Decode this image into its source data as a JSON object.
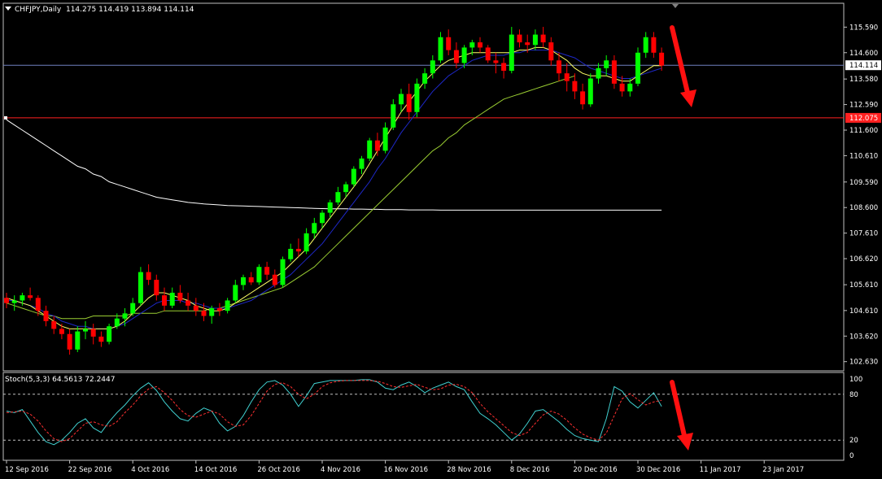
{
  "header": {
    "symbol_label": "CHFJPY,Daily",
    "ohlc_label": "114.275 114.419 113.894 114.114"
  },
  "stoch_header": {
    "label": "Stoch(5,3,3) 64.5613 72.2447"
  },
  "colors": {
    "background": "#000000",
    "bull_candle": "#00ff00",
    "bear_candle": "#ff0000",
    "ma_fast": "#ffff66",
    "ma_mid": "#1e28c8",
    "ma_slow": "#9acd32",
    "ma_long": "#ffffff",
    "stoch_main": "#40d0d0",
    "stoch_signal": "#ff3030",
    "support_line": "#ff2020",
    "current_line": "#7080c0",
    "arrow": "#ff1010"
  },
  "chart_data": [
    {
      "type": "candlestick",
      "symbol": "CHFJPY",
      "timeframe": "Daily",
      "ylim": [
        102.4,
        116.2
      ],
      "y_ticks": [
        "115.590",
        "114.600",
        "113.580",
        "112.590",
        "111.600",
        "110.610",
        "109.590",
        "108.600",
        "107.610",
        "106.620",
        "105.610",
        "104.610",
        "103.620",
        "102.630"
      ],
      "x_tick_labels": [
        "12 Sep 2016",
        "22 Sep 2016",
        "4 Oct 2016",
        "14 Oct 2016",
        "26 Oct 2016",
        "4 Nov 2016",
        "16 Nov 2016",
        "28 Nov 2016",
        "8 Dec 2016",
        "20 Dec 2016",
        "30 Dec 2016",
        "11 Jan 2017",
        "23 Jan 2017"
      ],
      "x_tick_index": [
        0,
        8,
        16,
        24,
        32,
        40,
        48,
        56,
        64,
        72,
        80,
        88,
        96
      ],
      "current_price": "114.114",
      "support_level": "112.075",
      "candles": [
        [
          105.1,
          105.3,
          104.7,
          104.9
        ],
        [
          104.9,
          105.2,
          104.6,
          105.0
        ],
        [
          105.0,
          105.3,
          104.8,
          105.2
        ],
        [
          105.2,
          105.5,
          105.0,
          105.1
        ],
        [
          105.1,
          105.2,
          104.4,
          104.6
        ],
        [
          104.6,
          104.8,
          104.0,
          104.2
        ],
        [
          104.2,
          104.4,
          103.7,
          103.9
        ],
        [
          103.9,
          104.1,
          103.5,
          103.7
        ],
        [
          103.7,
          103.9,
          102.9,
          103.1
        ],
        [
          103.1,
          104.0,
          103.0,
          103.8
        ],
        [
          103.8,
          104.2,
          103.5,
          103.9
        ],
        [
          103.9,
          104.1,
          103.3,
          103.6
        ],
        [
          103.6,
          103.8,
          103.2,
          103.4
        ],
        [
          103.4,
          104.1,
          103.3,
          104.0
        ],
        [
          104.0,
          104.5,
          103.9,
          104.3
        ],
        [
          104.3,
          104.7,
          104.0,
          104.5
        ],
        [
          104.5,
          105.1,
          104.4,
          104.9
        ],
        [
          104.9,
          106.3,
          104.8,
          106.1
        ],
        [
          106.1,
          106.4,
          105.6,
          105.8
        ],
        [
          105.8,
          106.0,
          105.0,
          105.2
        ],
        [
          105.2,
          105.5,
          104.6,
          104.8
        ],
        [
          104.8,
          105.5,
          104.7,
          105.3
        ],
        [
          105.3,
          105.6,
          104.9,
          105.0
        ],
        [
          105.0,
          105.3,
          104.6,
          104.8
        ],
        [
          104.8,
          105.1,
          104.4,
          104.6
        ],
        [
          104.6,
          104.9,
          104.2,
          104.4
        ],
        [
          104.4,
          104.8,
          104.1,
          104.7
        ],
        [
          104.7,
          104.9,
          104.4,
          104.6
        ],
        [
          104.6,
          105.1,
          104.5,
          105.0
        ],
        [
          105.0,
          105.8,
          104.9,
          105.6
        ],
        [
          105.6,
          106.0,
          105.4,
          105.9
        ],
        [
          105.9,
          106.1,
          105.6,
          105.7
        ],
        [
          105.7,
          106.4,
          105.6,
          106.3
        ],
        [
          106.3,
          106.5,
          105.8,
          106.0
        ],
        [
          106.0,
          106.2,
          105.5,
          105.6
        ],
        [
          105.6,
          106.7,
          105.5,
          106.6
        ],
        [
          106.6,
          107.2,
          106.5,
          107.0
        ],
        [
          107.0,
          107.4,
          106.7,
          106.9
        ],
        [
          106.9,
          107.8,
          106.8,
          107.6
        ],
        [
          107.6,
          108.2,
          107.4,
          108.0
        ],
        [
          108.0,
          108.5,
          107.8,
          108.4
        ],
        [
          108.4,
          108.9,
          108.2,
          108.8
        ],
        [
          108.8,
          109.4,
          108.7,
          109.2
        ],
        [
          109.2,
          109.6,
          109.0,
          109.5
        ],
        [
          109.5,
          110.2,
          109.4,
          110.1
        ],
        [
          110.1,
          110.6,
          109.9,
          110.5
        ],
        [
          110.5,
          111.3,
          110.4,
          111.2
        ],
        [
          111.2,
          111.5,
          110.6,
          110.8
        ],
        [
          110.8,
          111.9,
          110.7,
          111.7
        ],
        [
          111.7,
          112.8,
          111.6,
          112.6
        ],
        [
          112.6,
          113.2,
          112.3,
          113.0
        ],
        [
          113.0,
          113.4,
          112.0,
          112.3
        ],
        [
          112.3,
          113.6,
          112.1,
          113.4
        ],
        [
          113.4,
          114.0,
          113.2,
          113.8
        ],
        [
          113.8,
          114.5,
          113.6,
          114.3
        ],
        [
          114.3,
          115.4,
          114.2,
          115.2
        ],
        [
          115.2,
          115.5,
          114.5,
          114.7
        ],
        [
          114.7,
          115.0,
          114.0,
          114.2
        ],
        [
          114.2,
          114.9,
          114.0,
          114.8
        ],
        [
          114.8,
          115.1,
          114.5,
          115.0
        ],
        [
          115.0,
          115.2,
          114.6,
          114.8
        ],
        [
          114.8,
          114.9,
          114.2,
          114.3
        ],
        [
          114.3,
          114.6,
          113.8,
          114.2
        ],
        [
          114.2,
          114.4,
          113.6,
          113.9
        ],
        [
          113.9,
          115.6,
          113.8,
          115.3
        ],
        [
          115.3,
          115.5,
          114.8,
          115.0
        ],
        [
          115.0,
          115.3,
          114.6,
          114.9
        ],
        [
          114.9,
          115.5,
          114.7,
          115.3
        ],
        [
          115.3,
          115.6,
          114.8,
          115.0
        ],
        [
          115.0,
          115.2,
          114.1,
          114.3
        ],
        [
          114.3,
          114.6,
          113.5,
          113.8
        ],
        [
          113.8,
          114.2,
          113.1,
          113.5
        ],
        [
          113.5,
          113.8,
          112.8,
          113.1
        ],
        [
          113.1,
          113.4,
          112.4,
          112.6
        ],
        [
          112.6,
          113.8,
          112.5,
          113.6
        ],
        [
          113.6,
          114.2,
          113.4,
          114.0
        ],
        [
          114.0,
          114.5,
          113.7,
          114.3
        ],
        [
          114.3,
          114.5,
          113.2,
          113.4
        ],
        [
          113.4,
          113.7,
          112.9,
          113.1
        ],
        [
          113.1,
          113.6,
          112.9,
          113.4
        ],
        [
          113.4,
          114.8,
          113.3,
          114.6
        ],
        [
          114.6,
          115.4,
          114.4,
          115.2
        ],
        [
          115.2,
          115.4,
          114.4,
          114.6
        ],
        [
          114.6,
          114.8,
          113.9,
          114.1
        ]
      ],
      "ma_fast": [
        105.1,
        105.0,
        104.9,
        104.8,
        104.6,
        104.4,
        104.2,
        104.0,
        103.9,
        103.9,
        103.9,
        103.9,
        103.9,
        103.9,
        104.0,
        104.2,
        104.5,
        104.8,
        105.1,
        105.3,
        105.3,
        105.2,
        105.1,
        105.0,
        104.8,
        104.7,
        104.6,
        104.6,
        104.7,
        104.9,
        105.1,
        105.3,
        105.5,
        105.7,
        105.9,
        106.1,
        106.4,
        106.7,
        107.0,
        107.4,
        107.8,
        108.2,
        108.6,
        109.0,
        109.4,
        109.8,
        110.3,
        110.8,
        111.3,
        111.8,
        112.3,
        112.7,
        113.1,
        113.5,
        113.8,
        114.1,
        114.3,
        114.4,
        114.5,
        114.6,
        114.6,
        114.6,
        114.6,
        114.6,
        114.6,
        114.7,
        114.7,
        114.8,
        114.8,
        114.7,
        114.5,
        114.3,
        114.0,
        113.8,
        113.7,
        113.7,
        113.7,
        113.6,
        113.5,
        113.5,
        113.7,
        113.9,
        114.1,
        114.1
      ],
      "ma_mid": [
        105.0,
        105.0,
        104.9,
        104.8,
        104.7,
        104.5,
        104.4,
        104.2,
        104.1,
        104.0,
        104.0,
        103.9,
        103.9,
        103.9,
        104.0,
        104.1,
        104.3,
        104.5,
        104.7,
        104.9,
        105.0,
        105.0,
        105.0,
        104.9,
        104.9,
        104.8,
        104.7,
        104.7,
        104.7,
        104.8,
        104.9,
        105.0,
        105.2,
        105.4,
        105.6,
        105.8,
        106.0,
        106.3,
        106.6,
        106.9,
        107.2,
        107.6,
        108.0,
        108.4,
        108.8,
        109.2,
        109.6,
        110.1,
        110.5,
        111.0,
        111.5,
        111.9,
        112.3,
        112.7,
        113.1,
        113.4,
        113.7,
        113.9,
        114.1,
        114.3,
        114.4,
        114.5,
        114.5,
        114.5,
        114.6,
        114.6,
        114.7,
        114.7,
        114.7,
        114.7,
        114.6,
        114.5,
        114.4,
        114.2,
        114.0,
        113.9,
        113.8,
        113.7,
        113.6,
        113.6,
        113.7,
        113.8,
        113.9,
        114.0
      ],
      "ma_slow": [
        104.9,
        104.8,
        104.7,
        104.6,
        104.5,
        104.4,
        104.4,
        104.3,
        104.3,
        104.3,
        104.3,
        104.4,
        104.4,
        104.4,
        104.4,
        104.4,
        104.5,
        104.5,
        104.5,
        104.5,
        104.6,
        104.6,
        104.6,
        104.6,
        104.6,
        104.6,
        104.7,
        104.7,
        104.8,
        104.9,
        105.0,
        105.1,
        105.2,
        105.3,
        105.4,
        105.5,
        105.7,
        105.9,
        106.1,
        106.3,
        106.6,
        106.9,
        107.2,
        107.5,
        107.8,
        108.1,
        108.4,
        108.7,
        109.0,
        109.3,
        109.6,
        109.9,
        110.2,
        110.5,
        110.8,
        111.0,
        111.3,
        111.5,
        111.8,
        112.0,
        112.2,
        112.4,
        112.6,
        112.8,
        112.9,
        113.0,
        113.1,
        113.2,
        113.3,
        113.4,
        113.5,
        113.6,
        113.7
      ],
      "ma_slow_start_index": 0,
      "ma_long": [
        112.0,
        111.8,
        111.6,
        111.4,
        111.2,
        111.0,
        110.8,
        110.6,
        110.4,
        110.2,
        110.1,
        109.9,
        109.8,
        109.6,
        109.5,
        109.4,
        109.3,
        109.2,
        109.1,
        109.0,
        108.95,
        108.9,
        108.85,
        108.8,
        108.77,
        108.74,
        108.72,
        108.7,
        108.68,
        108.67,
        108.66,
        108.65,
        108.64,
        108.63,
        108.62,
        108.61,
        108.6,
        108.59,
        108.58,
        108.57,
        108.56,
        108.55,
        108.55,
        108.55,
        108.54,
        108.54,
        108.53,
        108.53,
        108.52,
        108.52,
        108.52,
        108.51,
        108.51,
        108.51,
        108.51,
        108.5,
        108.5,
        108.5,
        108.5,
        108.5,
        108.5,
        108.5,
        108.5,
        108.5,
        108.5,
        108.5,
        108.5,
        108.5,
        108.5,
        108.5,
        108.5,
        108.5,
        108.5,
        108.5,
        108.5,
        108.5,
        108.5,
        108.5,
        108.5,
        108.5,
        108.5,
        108.5,
        108.5,
        108.5
      ],
      "annotation": "down-arrow"
    },
    {
      "type": "line",
      "title": "Stoch(5,3,3) 64.5613 72.2447",
      "ylim": [
        0,
        100
      ],
      "y_ticks": [
        "100",
        "80",
        "20",
        "0"
      ],
      "levels": [
        80,
        20
      ],
      "series": [
        {
          "name": "main",
          "values": [
            58,
            56,
            60,
            45,
            30,
            18,
            14,
            20,
            30,
            42,
            48,
            36,
            30,
            44,
            56,
            66,
            78,
            88,
            95,
            85,
            70,
            58,
            48,
            45,
            55,
            62,
            58,
            42,
            32,
            38,
            52,
            70,
            86,
            96,
            98,
            92,
            80,
            64,
            78,
            94,
            96,
            98,
            98,
            98,
            98,
            99,
            99,
            96,
            88,
            86,
            92,
            96,
            90,
            82,
            88,
            92,
            96,
            90,
            86,
            70,
            55,
            48,
            40,
            30,
            20,
            28,
            42,
            58,
            60,
            52,
            44,
            34,
            26,
            22,
            20,
            18,
            48,
            90,
            84,
            70,
            62,
            72,
            82,
            64
          ]
        },
        {
          "name": "signal",
          "values": [
            56,
            57,
            58,
            54,
            45,
            32,
            22,
            18,
            22,
            32,
            42,
            44,
            40,
            38,
            44,
            56,
            66,
            78,
            87,
            90,
            82,
            72,
            60,
            52,
            50,
            54,
            58,
            54,
            44,
            38,
            40,
            52,
            68,
            84,
            93,
            95,
            90,
            80,
            74,
            80,
            90,
            95,
            97,
            98,
            98,
            98,
            98,
            97,
            94,
            90,
            89,
            91,
            93,
            89,
            86,
            87,
            92,
            93,
            90,
            82,
            68,
            57,
            48,
            39,
            30,
            26,
            30,
            42,
            53,
            58,
            54,
            46,
            36,
            28,
            23,
            20,
            29,
            52,
            74,
            81,
            73,
            66,
            70,
            72
          ]
        }
      ],
      "annotation": "down-arrow"
    }
  ]
}
